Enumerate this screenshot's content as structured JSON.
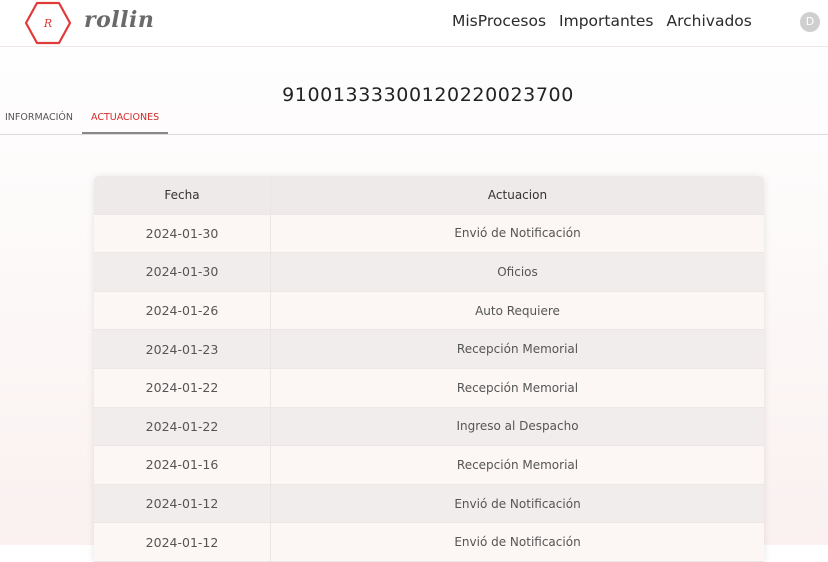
{
  "brand": {
    "logo_letter": "R",
    "name": "rollin",
    "accent": "#e03a3a"
  },
  "nav": {
    "items": [
      "MisProcesos",
      "Importantes",
      "Archivados"
    ],
    "avatar_initial": "D"
  },
  "process": {
    "number": "91001333300120220023700"
  },
  "tabs": {
    "info": "INFORMACIÓN",
    "actuaciones": "ACTUACIONES",
    "active": "actuaciones"
  },
  "table": {
    "columns": [
      "Fecha",
      "Actuacion"
    ],
    "rows": [
      {
        "fecha": "2024-01-30",
        "actuacion": "Envió de Notificación"
      },
      {
        "fecha": "2024-01-30",
        "actuacion": "Oficios"
      },
      {
        "fecha": "2024-01-26",
        "actuacion": "Auto Requiere"
      },
      {
        "fecha": "2024-01-23",
        "actuacion": "Recepción Memorial"
      },
      {
        "fecha": "2024-01-22",
        "actuacion": "Recepción Memorial"
      },
      {
        "fecha": "2024-01-22",
        "actuacion": "Ingreso al Despacho"
      },
      {
        "fecha": "2024-01-16",
        "actuacion": "Recepción Memorial"
      },
      {
        "fecha": "2024-01-12",
        "actuacion": "Envió de Notificación"
      },
      {
        "fecha": "2024-01-12",
        "actuacion": "Envió de Notificación"
      }
    ]
  }
}
